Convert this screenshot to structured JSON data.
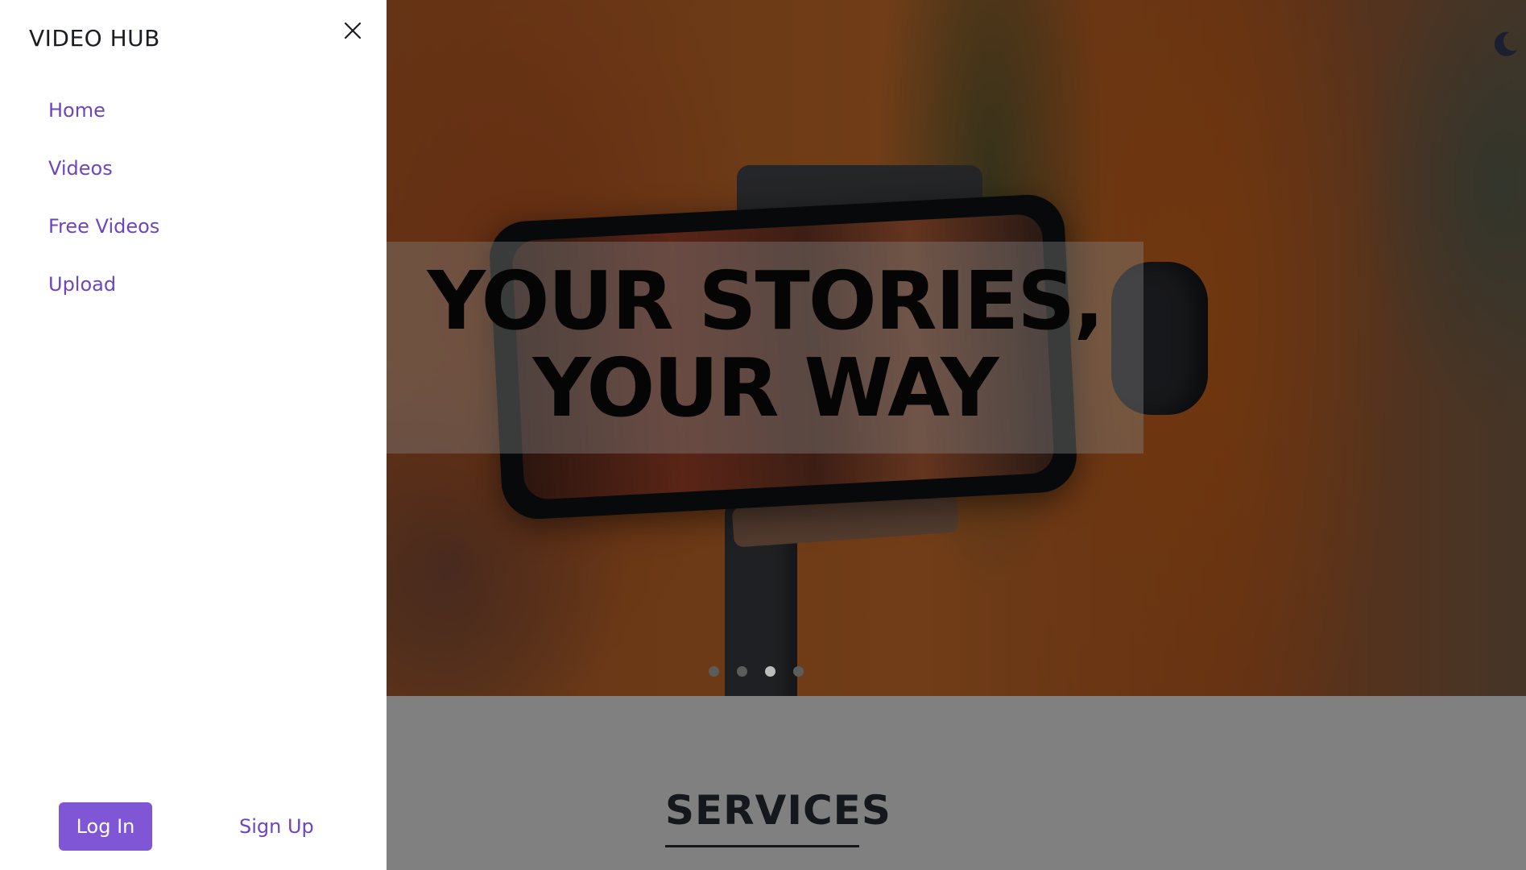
{
  "app": {
    "title": "VIDEO HUB"
  },
  "drawer": {
    "nav": [
      {
        "label": "Home"
      },
      {
        "label": "Videos"
      },
      {
        "label": "Free Videos"
      },
      {
        "label": "Upload"
      }
    ],
    "login_label": "Log In",
    "signup_label": "Sign Up",
    "accent_color": "#6b46c1",
    "button_color": "#7e56d6"
  },
  "hero": {
    "headline_line1": "YOUR STORIES,",
    "headline_line2": "YOUR WAY",
    "carousel": {
      "slide_count": 4,
      "active_slide": 3
    }
  },
  "sections": {
    "services_title": "SERVICES"
  },
  "icons": {
    "close": "close-icon",
    "theme": "moon-icon"
  }
}
